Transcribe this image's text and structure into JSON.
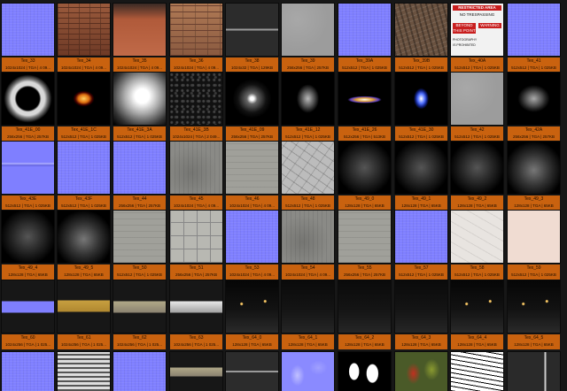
{
  "tiles": [
    {
      "name": "Tex_33",
      "info": "1024x1024 | TGA | 4 09...",
      "look": "normal"
    },
    {
      "name": "Tex_34",
      "info": "1024x1024 | TGA | 4 09...",
      "look": "brick"
    },
    {
      "name": "Tex_35",
      "info": "1024x1024 | TGA | 4 09...",
      "look": "redwall"
    },
    {
      "name": "Tex_36",
      "info": "1024x1024 | TGA | 4 09...",
      "look": "brick2"
    },
    {
      "name": "Tex_38",
      "info": "1024x32 | TGA | 129KB",
      "look": "darkline"
    },
    {
      "name": "Tex_39",
      "info": "256x256 | TGA | 257KB",
      "look": "grey"
    },
    {
      "name": "Tex_39A",
      "info": "512x512 | TGA | 1 025KB",
      "look": "normal"
    },
    {
      "name": "Tex_39B",
      "info": "512x512 | TGA | 1 025KB",
      "look": "bark"
    },
    {
      "name": "Tex_40A",
      "info": "512x512 | TGA | 1 025KB",
      "look": "sign"
    },
    {
      "name": "Tex_41",
      "info": "512x512 | TGA | 1 025KB",
      "look": "normal"
    },
    {
      "name": "Tex_41E_00",
      "info": "256x256 | TGA | 257KB",
      "look": "ring"
    },
    {
      "name": "Tex_41E_1C",
      "info": "512x512 | TGA | 1 025KB",
      "look": "fire"
    },
    {
      "name": "Tex_41E_3A",
      "info": "512x512 | TGA | 1 025KB",
      "look": "softglow"
    },
    {
      "name": "Tex_41E_3B",
      "info": "1024x1024 | TGA | 2 049...",
      "look": "noisy"
    },
    {
      "name": "Tex_41E_09",
      "info": "256x256 | TGA | 257KB",
      "look": "dot"
    },
    {
      "name": "Tex_41E_12",
      "info": "512x512 | TGA | 1 025KB",
      "look": "smudge"
    },
    {
      "name": "Tex_41E_26",
      "info": "512x256 | TGA | 513KB",
      "look": "flare"
    },
    {
      "name": "Tex_41E_30",
      "info": "512x512 | TGA | 1 025KB",
      "look": "blueflare"
    },
    {
      "name": "Tex_42",
      "info": "512x512 | TGA | 1 025KB",
      "look": "grey"
    },
    {
      "name": "Tex_42A",
      "info": "256x256 | TGA | 257KB",
      "look": "smoke"
    },
    {
      "name": "Tex_43E",
      "info": "512x512 | TGA | 1 025KB",
      "look": "bluestripe"
    },
    {
      "name": "Tex_43F",
      "info": "512x512 | TGA | 1 025KB",
      "look": "normal"
    },
    {
      "name": "Tex_44",
      "info": "256x256 | TGA | 257KB",
      "look": "normal"
    },
    {
      "name": "Tex_45",
      "info": "1024x1024 | TGA | 4 09...",
      "look": "concrete"
    },
    {
      "name": "Tex_46",
      "info": "1024x1024 | TGA | 4 09...",
      "look": "concrete2"
    },
    {
      "name": "Tex_48",
      "info": "512x512 | TGA | 1 025KB",
      "look": "cracked"
    },
    {
      "name": "Tex_49_0",
      "info": "128x128 | TGA | 65KB",
      "look": "blob"
    },
    {
      "name": "Tex_49_1",
      "info": "128x128 | TGA | 65KB",
      "look": "blob"
    },
    {
      "name": "Tex_49_2",
      "info": "128x128 | TGA | 65KB",
      "look": "blob"
    },
    {
      "name": "Tex_49_3",
      "info": "128x128 | TGA | 65KB",
      "look": "blob2"
    },
    {
      "name": "Tex_49_4",
      "info": "128x128 | TGA | 65KB",
      "look": "blob"
    },
    {
      "name": "Tex_49_5",
      "info": "128x128 | TGA | 65KB",
      "look": "blob2"
    },
    {
      "name": "Tex_50",
      "info": "512x512 | TGA | 1 025KB",
      "look": "concrete2"
    },
    {
      "name": "Tex_51",
      "info": "256x256 | TGA | 257KB",
      "look": "tiles"
    },
    {
      "name": "Tex_53",
      "info": "1024x1024 | TGA | 4 09...",
      "look": "normal"
    },
    {
      "name": "Tex_54",
      "info": "1024x1024 | TGA | 4 09...",
      "look": "concrete"
    },
    {
      "name": "Tex_55",
      "info": "256x256 | TGA | 257KB",
      "look": "concrete2"
    },
    {
      "name": "Tex_57",
      "info": "512x512 | TGA | 1 025KB",
      "look": "normal"
    },
    {
      "name": "Tex_58",
      "info": "512x512 | TGA | 1 025KB",
      "look": "white"
    },
    {
      "name": "Tex_59",
      "info": "512x512 | TGA | 1 025KB",
      "look": "pink"
    },
    {
      "name": "Tex_60",
      "info": "1024x256 | TGA | 1 025...",
      "look": "stripnormal"
    },
    {
      "name": "Tex_61",
      "info": "1024x256 | TGA | 1 025...",
      "look": "stripgold"
    },
    {
      "name": "Tex_62",
      "info": "1024x256 | TGA | 1 025...",
      "look": "stripgrey"
    },
    {
      "name": "Tex_63",
      "info": "1024x256 | TGA | 1 025...",
      "look": "stripwhite"
    },
    {
      "name": "Tex_64_0",
      "info": "128x128 | TGA | 65KB",
      "look": "night2"
    },
    {
      "name": "Tex_64_1",
      "info": "128x128 | TGA | 65KB",
      "look": "night"
    },
    {
      "name": "Tex_64_2",
      "info": "128x128 | TGA | 65KB",
      "look": "night"
    },
    {
      "name": "Tex_64_3",
      "info": "128x128 | TGA | 65KB",
      "look": "night"
    },
    {
      "name": "Tex_64_4",
      "info": "128x128 | TGA | 65KB",
      "look": "night2"
    },
    {
      "name": "Tex_64_5",
      "info": "128x128 | TGA | 65KB",
      "look": "night2"
    }
  ],
  "partial_row": [
    "normal",
    "grate",
    "normal",
    "stripgrey",
    "darkline",
    "bumps",
    "leaves",
    "leafcolor",
    "map",
    "door"
  ],
  "sign": {
    "line1": "RESTRICTED AREA",
    "line2": "NO TRESPASSING",
    "line3": "BEYOND THIS POINT",
    "line4": "WARNING",
    "line5": "PHOTOGRAPHY IS PROHIBITED"
  },
  "colors": {
    "caption_bg": "#c9620f",
    "page_bg": "#171717",
    "normal_map": "#7f7fff"
  }
}
